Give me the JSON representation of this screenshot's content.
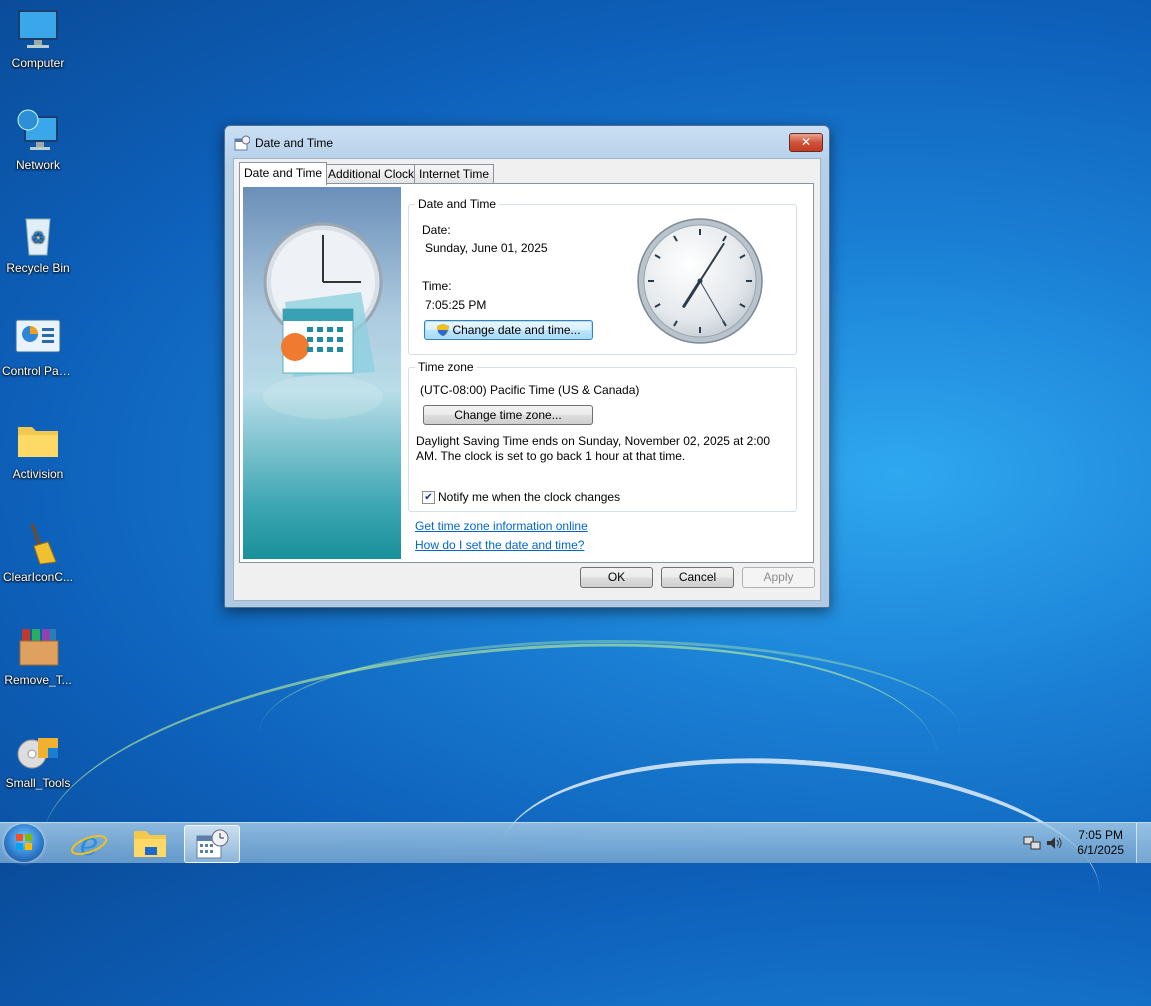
{
  "desktop": {
    "icons": [
      {
        "label": "Computer",
        "icon": "computer-icon"
      },
      {
        "label": "Network",
        "icon": "network-icon"
      },
      {
        "label": "Recycle Bin",
        "icon": "recycle-bin-icon"
      },
      {
        "label": "Control Panel",
        "icon": "control-panel-icon"
      },
      {
        "label": "Activision",
        "icon": "folder-icon"
      },
      {
        "label": "ClearIconC...",
        "icon": "broom-icon"
      },
      {
        "label": "Remove_T...",
        "icon": "archive-icon"
      },
      {
        "label": "Small_Tools",
        "icon": "installer-icon"
      }
    ]
  },
  "window": {
    "title": "Date and Time",
    "close_label": "✕",
    "tabs": [
      {
        "label": "Date and Time",
        "active": true
      },
      {
        "label": "Additional Clocks",
        "active": false
      },
      {
        "label": "Internet Time",
        "active": false
      }
    ],
    "date_time_group": {
      "title": "Date and Time",
      "date_label": "Date:",
      "date_value": "Sunday, June 01, 2025",
      "time_label": "Time:",
      "time_value": "7:05:25 PM",
      "change_button": "Change date and time..."
    },
    "clock": {
      "hour": 7,
      "minute": 5,
      "second": 25
    },
    "time_zone_group": {
      "title": "Time zone",
      "zone": "(UTC-08:00) Pacific Time (US & Canada)",
      "change_button": "Change time zone...",
      "dst_line1": "Daylight Saving Time ends on Sunday, November 02, 2025 at 2:00",
      "dst_line2": "AM. The clock is set to go back 1 hour at that time.",
      "notify_label": "Notify me when the clock changes",
      "notify_checked": true
    },
    "links": {
      "tz_info": "Get time zone information online",
      "how_to": "How do I set the date and time?"
    },
    "buttons": {
      "ok": "OK",
      "cancel": "Cancel",
      "apply": "Apply"
    }
  },
  "taskbar": {
    "items": [
      {
        "name": "internet-explorer",
        "active": false
      },
      {
        "name": "file-explorer",
        "active": false
      },
      {
        "name": "date-and-time",
        "active": true
      }
    ],
    "time": "7:05 PM",
    "date": "6/1/2025"
  }
}
